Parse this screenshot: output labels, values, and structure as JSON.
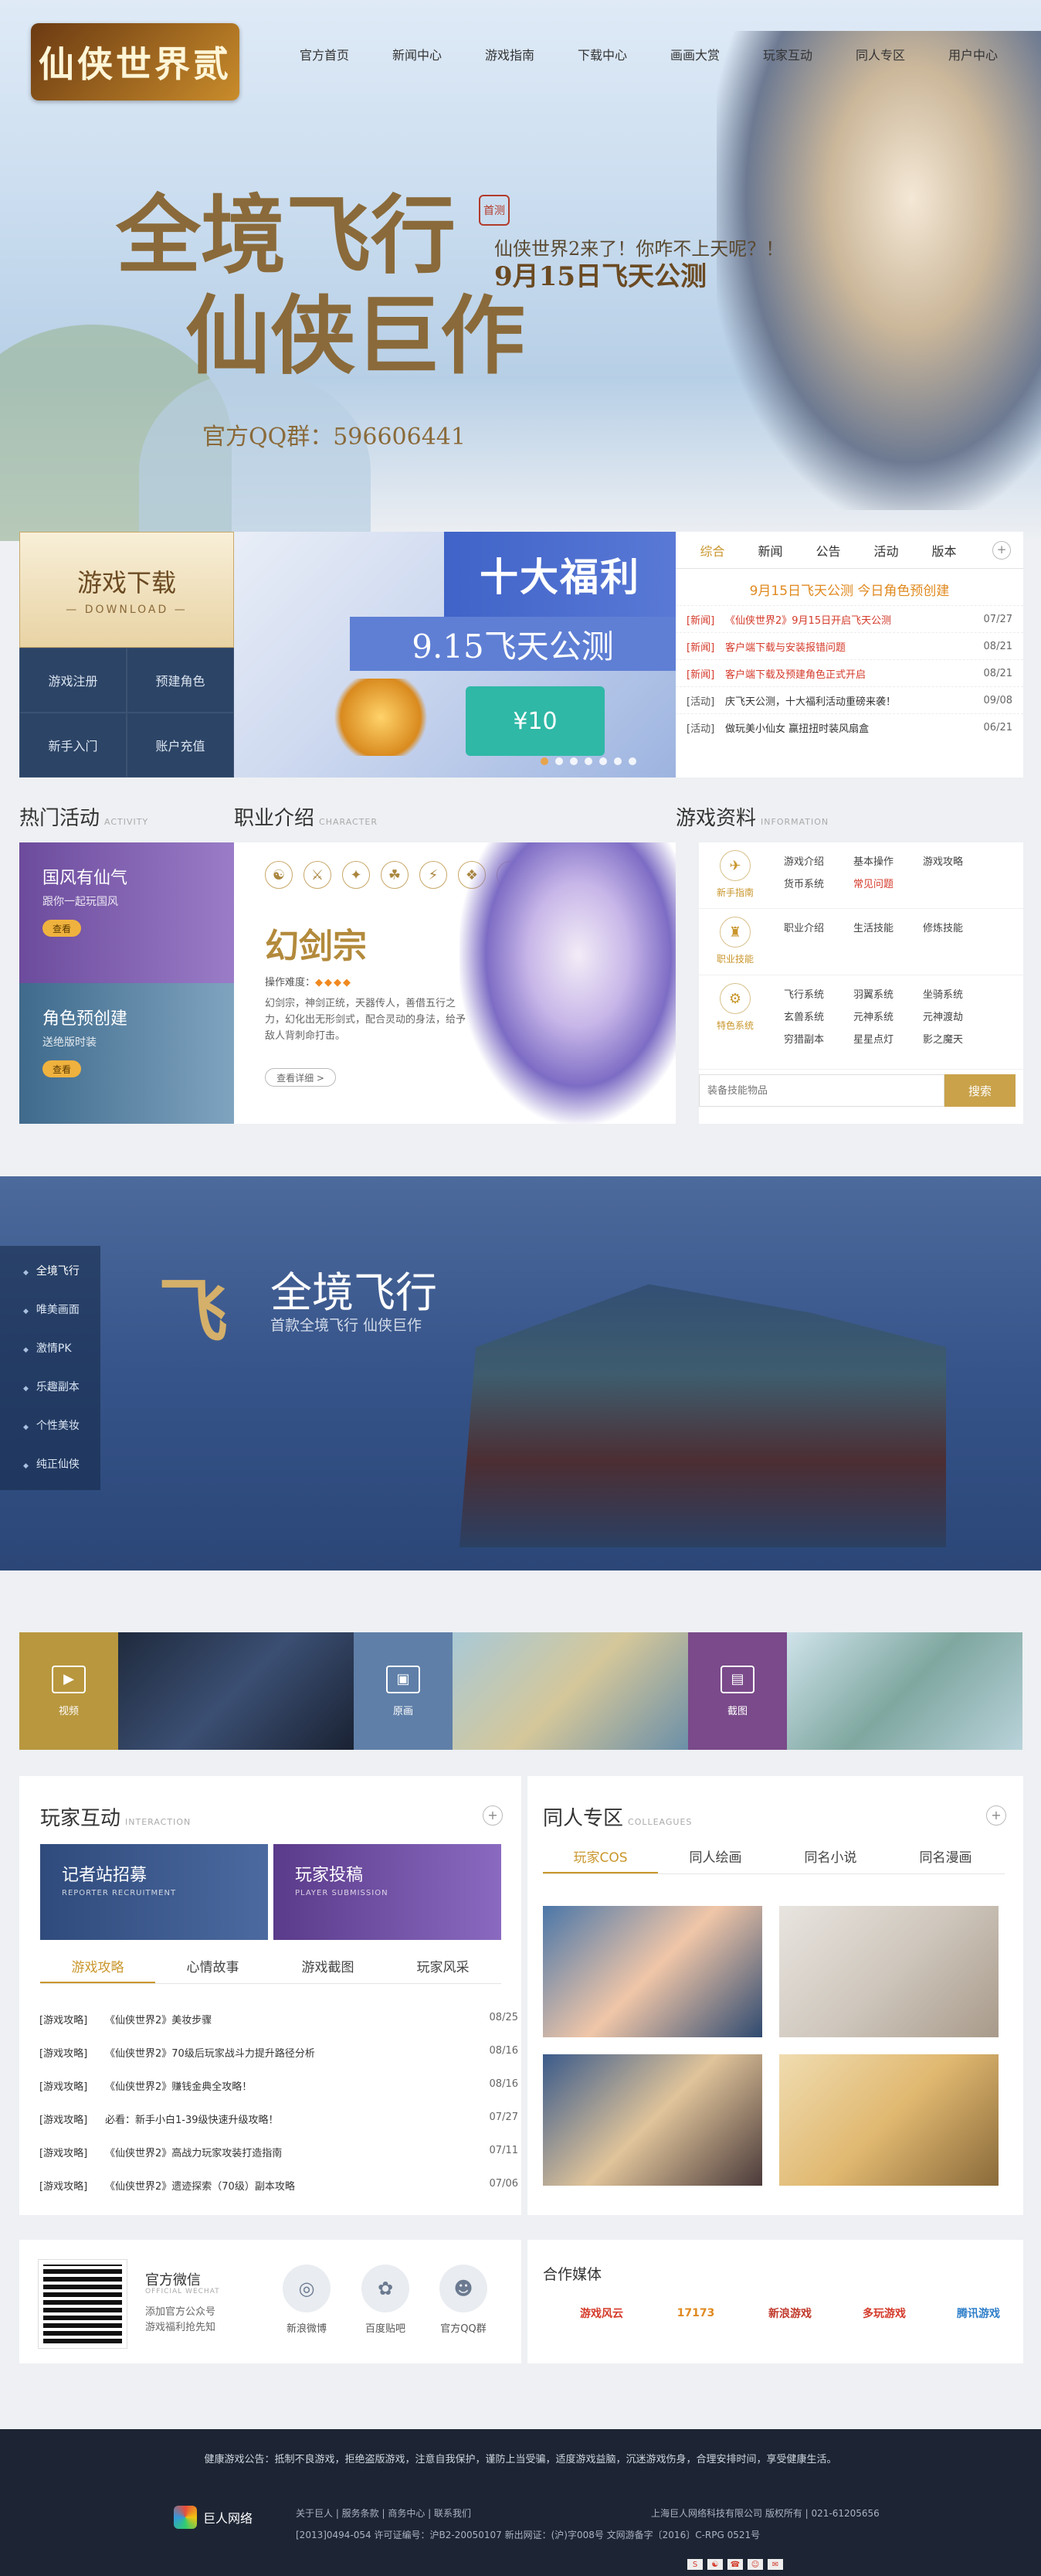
{
  "header": {
    "logo_text": "仙侠世界贰",
    "nav": [
      "官方首页",
      "新闻中心",
      "游戏指南",
      "下载中心",
      "画画大赏",
      "玩家互动",
      "同人专区",
      "用户中心"
    ]
  },
  "hero": {
    "slogan_line1": "全境飞行",
    "slogan_line2": "仙侠巨作",
    "stamp": "首测",
    "subtitle": "仙侠世界2来了！你咋不上天呢？！",
    "date": "9月15日飞天公测",
    "qq": "官方QQ群：596606441"
  },
  "download": {
    "title": "游戏下载",
    "subtitle": "— DOWNLOAD —"
  },
  "quick_links": [
    "游戏注册",
    "预建角色",
    "新手入门",
    "账户充值"
  ],
  "banner": {
    "title": "十大福利",
    "date": "9.15飞天公测",
    "jd": "¥10"
  },
  "news": {
    "tabs": [
      "综合",
      "新闻",
      "公告",
      "活动",
      "版本"
    ],
    "plus": "+",
    "headline": "9月15日飞天公测 今日角色预创建",
    "items": [
      {
        "tag": "[新闻]",
        "title": "《仙侠世界2》9月15日开启飞天公测",
        "date": "07/27",
        "red": true
      },
      {
        "tag": "[新闻]",
        "title": "客户端下载与安装报错问题",
        "date": "08/21",
        "red": true
      },
      {
        "tag": "[新闻]",
        "title": "客户端下载及预建角色正式开启",
        "date": "08/21",
        "red": true
      },
      {
        "tag": "[活动]",
        "title": "庆飞天公测，十大福利活动重磅来袭！",
        "date": "09/08",
        "red": false
      },
      {
        "tag": "[活动]",
        "title": "做玩美小仙女 赢扭扭时装风扇盒",
        "date": "06/21",
        "red": false
      }
    ]
  },
  "sections": {
    "activity": {
      "title": "热门活动",
      "en": "ACTIVITY"
    },
    "character": {
      "title": "职业介绍",
      "en": "CHARACTER"
    },
    "info": {
      "title": "游戏资料",
      "en": "INFORMATION"
    }
  },
  "activities": [
    {
      "title": "国风有仙气",
      "desc": "跟你一起玩国风",
      "btn": "查看",
      "color": "#6c4b9c"
    },
    {
      "title": "角色预创建",
      "desc": "送绝版时装",
      "btn": "查看",
      "color": "#3f6a8c"
    }
  ],
  "character": {
    "icons": [
      "☯",
      "⚔",
      "✦",
      "☘",
      "⚡",
      "❖",
      "✶",
      "☉"
    ],
    "name": "幻剑宗",
    "difficulty_label": "操作难度：",
    "difficulty_stars": "◆◆◆◆",
    "desc": "幻剑宗，神剑正统，天器传人，善借五行之力，幻化出无形剑式，配合灵动的身法，给予敌人背刺命打击。",
    "more": "查看详细 >"
  },
  "info": {
    "groups": [
      {
        "name": "新手指南",
        "icon": "✈",
        "links": [
          {
            "t": "游戏介绍"
          },
          {
            "t": "基本操作"
          },
          {
            "t": "游戏攻略"
          },
          {
            "t": "货币系统"
          },
          {
            "t": "常见问题",
            "red": true
          }
        ]
      },
      {
        "name": "职业技能",
        "icon": "♜",
        "links": [
          {
            "t": "职业介绍"
          },
          {
            "t": "生活技能"
          },
          {
            "t": "修炼技能"
          }
        ]
      },
      {
        "name": "特色系统",
        "icon": "⚙",
        "links": [
          {
            "t": "飞行系统"
          },
          {
            "t": "羽翼系统"
          },
          {
            "t": "坐骑系统"
          },
          {
            "t": "玄兽系统"
          },
          {
            "t": "元神系统"
          },
          {
            "t": "元神渡劫"
          },
          {
            "t": "穷猎副本"
          },
          {
            "t": "星星点灯"
          },
          {
            "t": "影之魔天"
          }
        ]
      }
    ],
    "search_placeholder": "装备技能物品",
    "search_btn": "搜索"
  },
  "feature": {
    "side_items": [
      "全境飞行",
      "唯美画面",
      "激情PK",
      "乐趣副本",
      "个性美妆",
      "纯正仙侠"
    ],
    "fly": "飞",
    "title": "全境飞行",
    "subtitle": "首款全境飞行 仙侠巨作"
  },
  "media": [
    {
      "label": "视频",
      "icon": "▶",
      "color": "#b8973e"
    },
    {
      "label": "原画",
      "icon": "▣",
      "color": "#5f7fa8"
    },
    {
      "label": "截图",
      "icon": "▤",
      "color": "#7a4a8a"
    }
  ],
  "interaction": {
    "title": "玩家互动",
    "en": "INTERACTION",
    "plus": "+",
    "cards": [
      {
        "title": "记者站招募",
        "en": "REPORTER RECRUITMENT"
      },
      {
        "title": "玩家投稿",
        "en": "PLAYER SUBMISSION"
      }
    ],
    "tabs": [
      "游戏攻略",
      "心情故事",
      "游戏截图",
      "玩家风采"
    ],
    "items": [
      {
        "tag": "[游戏攻略]",
        "title": "《仙侠世界2》美妆步骤",
        "date": "08/25"
      },
      {
        "tag": "[游戏攻略]",
        "title": "《仙侠世界2》70级后玩家战斗力提升路径分析",
        "date": "08/16"
      },
      {
        "tag": "[游戏攻略]",
        "title": "《仙侠世界2》赚钱金典全攻略！",
        "date": "08/16"
      },
      {
        "tag": "[游戏攻略]",
        "title": "必看：新手小白1-39级快速升级攻略！",
        "date": "07/27"
      },
      {
        "tag": "[游戏攻略]",
        "title": "《仙侠世界2》高战力玩家攻装打造指南",
        "date": "07/11"
      },
      {
        "tag": "[游戏攻略]",
        "title": "《仙侠世界2》遗迹探索（70级）副本攻略",
        "date": "07/06"
      }
    ]
  },
  "colleagues": {
    "title": "同人专区",
    "en": "COLLEAGUES",
    "plus": "+",
    "tabs": [
      "玩家COS",
      "同人绘画",
      "同名小说",
      "同名漫画"
    ]
  },
  "wechat": {
    "title": "官方微信",
    "en": "OFFICIAL WECHAT",
    "line1": "添加官方公众号",
    "line2": "游戏福利抢先知"
  },
  "social": [
    {
      "label": "新浪微博",
      "icon": "◎"
    },
    {
      "label": "百度贴吧",
      "icon": "✿"
    },
    {
      "label": "官方QQ群",
      "icon": "☻"
    }
  ],
  "partners": {
    "title": "合作媒体",
    "logos": [
      {
        "name": "游戏风云",
        "color": "#d43a2a"
      },
      {
        "name": "17173",
        "color": "#e08a20"
      },
      {
        "name": "新浪游戏",
        "color": "#c0392b"
      },
      {
        "name": "多玩游戏",
        "color": "#d43a2a"
      },
      {
        "name": "腾讯游戏",
        "color": "#2f7fc9"
      }
    ]
  },
  "footer": {
    "health": "健康游戏公告：抵制不良游戏，拒绝盗版游戏，注意自我保护，谨防上当受骗，适度游戏益脑，沉迷游戏伤身，合理安排时间，享受健康生活。",
    "brand": "巨人网络",
    "links": "关于巨人 | 服务条款 | 商务中心 | 联系我们",
    "company": "上海巨人网络科技有限公司 版权所有 | 021-61205656",
    "license": "[2013]0494-054 许可证编号：沪B2-20050107 新出网证：(沪)字008号 文网游备字〔2016〕C-RPG 0521号"
  }
}
